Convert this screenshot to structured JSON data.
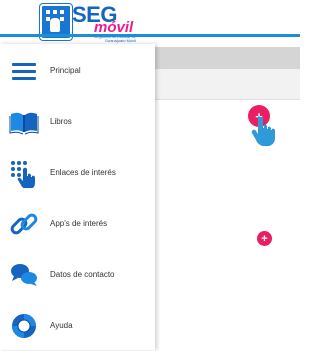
{
  "header": {
    "logo_main": "SEG",
    "logo_sub": "móvil",
    "logo_tagline": "Seguimiento Escolar de Guanajuato Móvil"
  },
  "menu": {
    "items": [
      {
        "label": "Principal",
        "icon": "hamburger-icon"
      },
      {
        "label": "Libros",
        "icon": "book-icon"
      },
      {
        "label": "Enlaces de interés",
        "icon": "touch-grid-icon"
      },
      {
        "label": "App's de interés",
        "icon": "link-chain-icon"
      },
      {
        "label": "Datos de contacto",
        "icon": "chat-bubbles-icon"
      },
      {
        "label": "Ayuda",
        "icon": "lifebuoy-icon"
      }
    ]
  },
  "fabs": {
    "top_symbol": "+",
    "bottom_symbol": "+"
  },
  "colors": {
    "primary_blue": "#1565c0",
    "accent_pink": "#e91e63",
    "stripe_blue": "#1a8fd8"
  }
}
